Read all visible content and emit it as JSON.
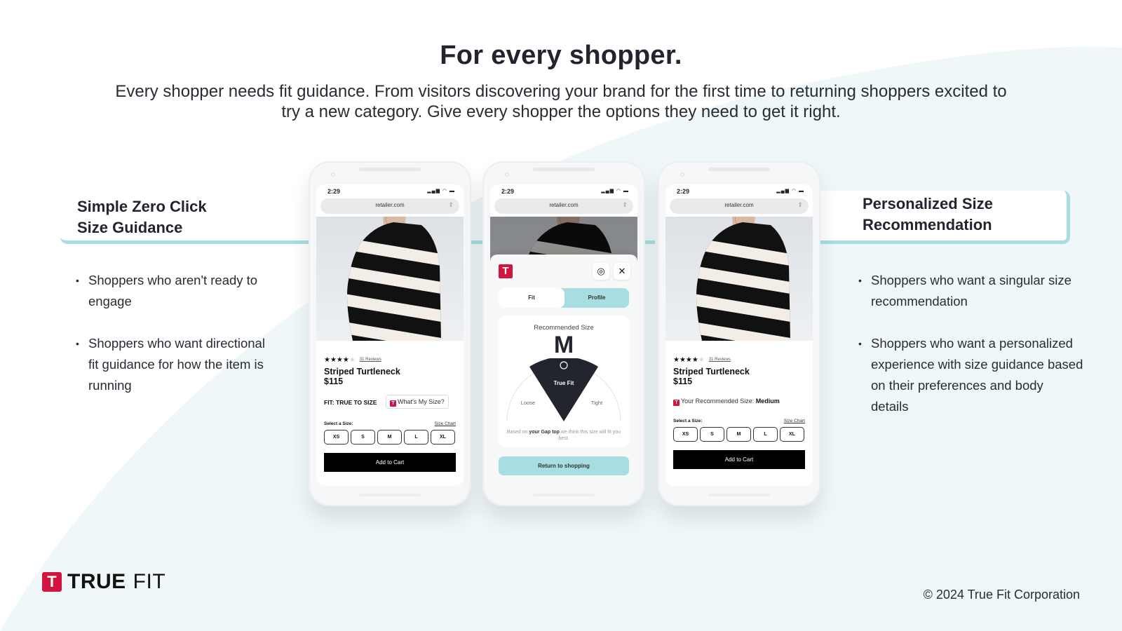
{
  "header": {
    "title": "For every shopper.",
    "subtitle": "Every shopper needs fit guidance. From visitors discovering your brand for the first time to returning shoppers excited to try a new category. Give every shopper the options they need to get it right."
  },
  "left_section": {
    "title_line1": "Simple Zero Click",
    "title_line2": "Size Guidance",
    "bullets": [
      "Shoppers who aren't ready to engage",
      "Shoppers who want directional fit guidance for how the item is running"
    ]
  },
  "right_section": {
    "title_line1": "Personalized Size",
    "title_line2": "Recommendation",
    "bullets": [
      "Shoppers who want a singular size recommendation",
      "Shoppers who want a personalized experience with size guidance based on their preferences and body details"
    ]
  },
  "phone_common": {
    "time": "2:29",
    "status_icons": "▂▄▆ ◠ ▬",
    "url": "retailer.com",
    "share_icon": "⇪"
  },
  "product": {
    "stars_filled": 4,
    "stars_total": 5,
    "stars_on": "★★★★",
    "stars_off": "★",
    "reviews": "31 Reviews",
    "name": "Striped Turtleneck",
    "price": "$115",
    "select_label": "Select a Size:",
    "size_chart": "Size Chart",
    "sizes": [
      "XS",
      "S",
      "M",
      "L",
      "XL"
    ],
    "add_to_cart": "Add to Cart"
  },
  "phone1": {
    "fit_label": "FIT: TRUE TO SIZE",
    "whats_my_size": "What's My Size?",
    "tf_mark": "T"
  },
  "phone2": {
    "logo_mark": "T",
    "profile_icon": "◎",
    "close_icon": "✕",
    "tabs": [
      "Fit",
      "Profile"
    ],
    "active_tab": "Profile",
    "rec_title": "Recommended Size",
    "rec_size": "M",
    "gauge": {
      "left": "Loose",
      "center": "True Fit",
      "right": "Tight"
    },
    "note_prefix": "Based on ",
    "note_bold": "your Gap top",
    "note_suffix": " we think this size will fit you best.",
    "return_button": "Return to shopping"
  },
  "phone3": {
    "tf_mark": "T",
    "rec_label": "Your Recommended Size: ",
    "rec_value": "Medium"
  },
  "footer": {
    "logo_mark": "T",
    "logo_true": "TRUE",
    "logo_fit": "FIT",
    "copyright": "© 2024 True Fit Corporation"
  },
  "colors": {
    "brand_red": "#d0163f",
    "accent_teal": "#a8dde2",
    "text_dark": "#23252e",
    "bg_tint": "#eef7f9"
  }
}
